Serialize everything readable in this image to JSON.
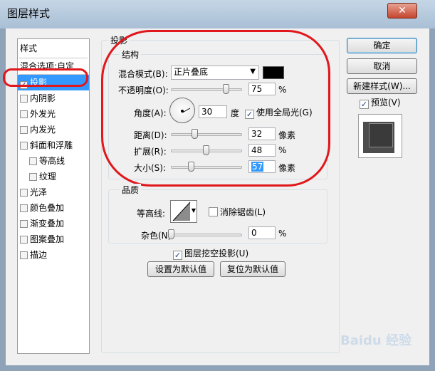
{
  "window": {
    "title": "图层样式",
    "close_glyph": "✕"
  },
  "styles_panel": {
    "header": "样式",
    "blend_options": "混合选项:自定",
    "items": [
      {
        "label": "投影",
        "checked": true,
        "selected": true
      },
      {
        "label": "内阴影",
        "checked": false
      },
      {
        "label": "外发光",
        "checked": false
      },
      {
        "label": "内发光",
        "checked": false
      },
      {
        "label": "斜面和浮雕",
        "checked": false
      },
      {
        "label": "等高线",
        "checked": false
      },
      {
        "label": "纹理",
        "checked": false
      },
      {
        "label": "光泽",
        "checked": false
      },
      {
        "label": "颜色叠加",
        "checked": false
      },
      {
        "label": "渐变叠加",
        "checked": false
      },
      {
        "label": "图案叠加",
        "checked": false
      },
      {
        "label": "描边",
        "checked": false
      }
    ]
  },
  "shadow": {
    "group_label": "投影",
    "structure_label": "结构",
    "blend_mode_label": "混合模式(B):",
    "blend_mode_value": "正片叠底",
    "blend_color": "#000000",
    "opacity_label": "不透明度(O):",
    "opacity_value": "75",
    "opacity_unit": "%",
    "angle_label": "角度(A):",
    "angle_value": "30",
    "angle_unit": "度",
    "global_light_label": "使用全局光(G)",
    "global_light_checked": true,
    "distance_label": "距离(D):",
    "distance_value": "32",
    "distance_unit": "像素",
    "spread_label": "扩展(R):",
    "spread_value": "48",
    "spread_unit": "%",
    "size_label": "大小(S):",
    "size_value": "57",
    "size_unit": "像素"
  },
  "quality": {
    "label": "品质",
    "contour_label": "等高线:",
    "antialias_label": "消除锯齿(L)",
    "antialias_checked": false,
    "noise_label": "杂色(N):",
    "noise_value": "0",
    "noise_unit": "%"
  },
  "knockout": {
    "label": "图层挖空投影(U)",
    "checked": true
  },
  "buttons": {
    "set_default": "设置为默认值",
    "reset_default": "复位为默认值",
    "ok": "确定",
    "cancel": "取消",
    "new_style": "新建样式(W)...",
    "preview": "预览(V)",
    "preview_checked": true
  },
  "watermark": "Baidu 经验"
}
